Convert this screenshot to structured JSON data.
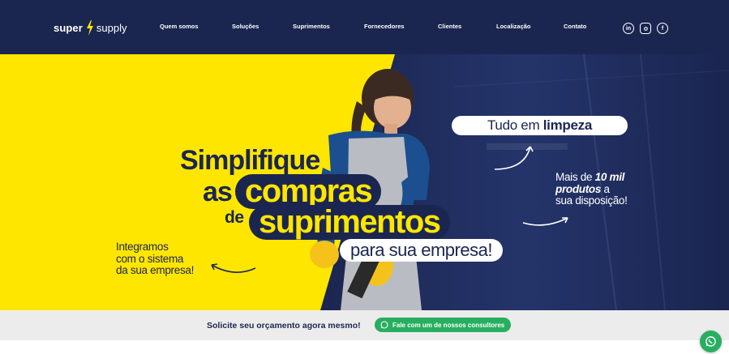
{
  "brand": {
    "super": "super",
    "supply": "supply"
  },
  "nav": {
    "items": [
      {
        "label": "Quem somos"
      },
      {
        "label": "Soluções"
      },
      {
        "label": "Suprimentos"
      },
      {
        "label": "Fornecedores"
      },
      {
        "label": "Clientes"
      },
      {
        "label": "Localização"
      },
      {
        "label": "Contato"
      }
    ],
    "socials": [
      {
        "icon": "linkedin-icon",
        "glyph": "in"
      },
      {
        "icon": "instagram-icon"
      },
      {
        "icon": "facebook-icon",
        "glyph": "f"
      }
    ]
  },
  "hero": {
    "line1": "Simplifique",
    "line2_prefix": "as",
    "line2_highlight": "compras",
    "line3_prefix": "de",
    "line3_highlight": "suprimentos",
    "line4": "para sua empresa!",
    "integramos": [
      "Integramos",
      "com o sistema",
      "da sua empresa!"
    ],
    "limpeza_prefix": "Tudo em ",
    "limpeza_bold": "limpeza",
    "mais_line1_prefix": "Mais de ",
    "mais_line1_bold": "10 mil",
    "mais_line2_bold": "produtos",
    "mais_line2_suffix": " a",
    "mais_line3": "sua disposição!"
  },
  "cta": {
    "text": "Solicite seu orçamento agora mesmo!",
    "button_label": "Fale com um de nossos consultores"
  },
  "colors": {
    "navy": "#1b2650",
    "yellow": "#ffe600",
    "green": "#27ae60"
  }
}
